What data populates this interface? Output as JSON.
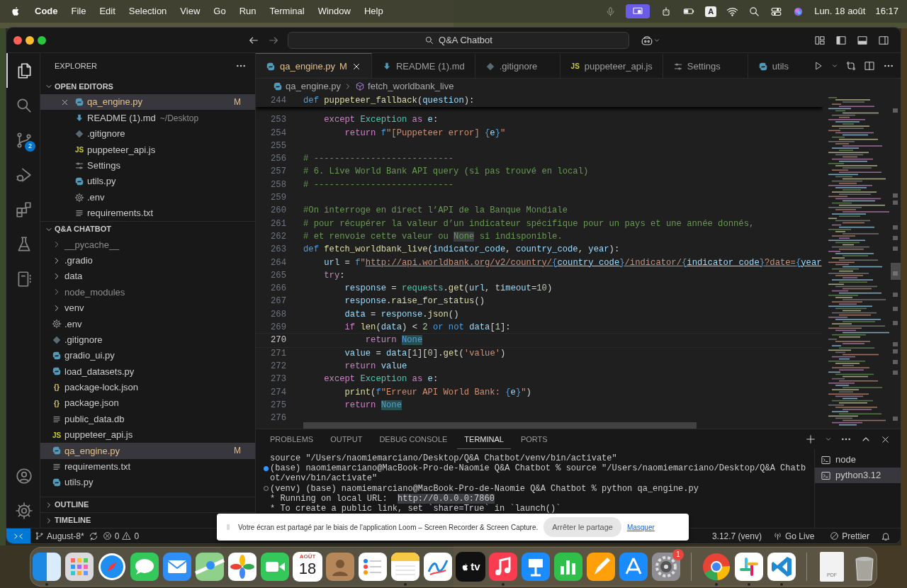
{
  "menu_bar": {
    "app": "Code",
    "menus": [
      "File",
      "Edit",
      "Selection",
      "View",
      "Go",
      "Run",
      "Terminal",
      "Window",
      "Help"
    ],
    "input_source": "A",
    "date": "Lun. 18 août",
    "time": "16:17"
  },
  "window": {
    "title": "Q&A Chatbot"
  },
  "activity_bar": [
    {
      "kind": "explorer",
      "selected": true
    },
    {
      "kind": "search",
      "selected": false
    },
    {
      "kind": "source-control",
      "selected": false,
      "badge": "2"
    },
    {
      "kind": "run-debug",
      "selected": false
    },
    {
      "kind": "extensions",
      "selected": false
    },
    {
      "kind": "testing",
      "selected": false
    },
    {
      "kind": "notebook",
      "selected": false
    }
  ],
  "activity_bar_bottom": [
    {
      "kind": "account"
    },
    {
      "kind": "settings"
    }
  ],
  "sidebar": {
    "title": "EXPLORER",
    "sections": [
      {
        "kind": "open-editors",
        "title": "OPEN EDITORS",
        "expanded": true,
        "items": [
          {
            "label": "qa_engine.py",
            "kind": "python-file",
            "status": "M",
            "selected": true
          },
          {
            "label": "README (1).md",
            "kind": "markdown-file",
            "description": "~/Desktop",
            "selected": false
          },
          {
            "label": ".gitignore",
            "kind": "git-file",
            "selected": false
          },
          {
            "label": "puppeteer_api.js",
            "kind": "js-file",
            "icon_text": "JS",
            "selected": false
          },
          {
            "label": "Settings",
            "kind": "settings-editor",
            "selected": false
          },
          {
            "label": "utils.py",
            "kind": "python-file",
            "selected": false
          },
          {
            "label": ".env",
            "kind": "env-file",
            "selected": false
          },
          {
            "label": "requirements.txt",
            "kind": "text-file",
            "selected": false
          }
        ]
      },
      {
        "kind": "folder-tree",
        "title": "Q&A CHATBOT",
        "expanded": true,
        "items": [
          {
            "label": "__pycache__",
            "kind": "folder",
            "expanded": false,
            "ignored": true,
            "selected": false
          },
          {
            "label": ".gradio",
            "kind": "folder",
            "expanded": false,
            "ignored": false,
            "selected": false
          },
          {
            "label": "data",
            "kind": "folder",
            "expanded": false,
            "ignored": false,
            "selected": false
          },
          {
            "label": "node_modules",
            "kind": "folder",
            "expanded": false,
            "ignored": true,
            "selected": false
          },
          {
            "label": "venv",
            "kind": "folder",
            "expanded": false,
            "ignored": false,
            "selected": false
          },
          {
            "label": ".env",
            "kind": "env-file",
            "ignored": false,
            "selected": false
          },
          {
            "label": ".gitignore",
            "kind": "git-file",
            "ignored": false,
            "selected": false
          },
          {
            "label": "gradio_ui.py",
            "kind": "python-file",
            "ignored": false,
            "selected": false
          },
          {
            "label": "load_datasets.py",
            "kind": "python-file",
            "ignored": false,
            "selected": false
          },
          {
            "label": "package-lock.json",
            "kind": "json-file",
            "icon_text": "{}",
            "ignored": false,
            "selected": false
          },
          {
            "label": "package.json",
            "kind": "json-file",
            "icon_text": "{}",
            "ignored": false,
            "selected": false
          },
          {
            "label": "public_data.db",
            "kind": "text-file",
            "ignored": false,
            "selected": false
          },
          {
            "label": "puppeteer_api.js",
            "kind": "js-file",
            "icon_text": "JS",
            "ignored": false,
            "selected": false
          },
          {
            "label": "qa_engine.py",
            "kind": "python-file",
            "status": "M",
            "ignored": false,
            "selected": true
          },
          {
            "label": "requirements.txt",
            "kind": "text-file",
            "ignored": false,
            "selected": false
          },
          {
            "label": "utils.py",
            "kind": "python-file",
            "ignored": false,
            "selected": false
          }
        ]
      },
      {
        "kind": "collapsed",
        "title": "OUTLINE",
        "expanded": false
      },
      {
        "kind": "collapsed",
        "title": "TIMELINE",
        "expanded": false
      }
    ]
  },
  "tabs": [
    {
      "label": "qa_engine.py",
      "kind": "python-file",
      "status": "M",
      "selected": true
    },
    {
      "label": "README (1).md",
      "kind": "markdown-file",
      "selected": false
    },
    {
      "label": ".gitignore",
      "kind": "git-file",
      "selected": false
    },
    {
      "label": "puppeteer_api.js",
      "kind": "js-file",
      "icon_text": "JS",
      "selected": false
    },
    {
      "label": "Settings",
      "kind": "settings-editor",
      "selected": false
    },
    {
      "label": "utils",
      "kind": "python-file",
      "selected": false
    }
  ],
  "breadcrumb": [
    {
      "label": "qa_engine.py",
      "kind": "python-file"
    },
    {
      "label": "fetch_worldbank_live",
      "kind": "method"
    }
  ],
  "editor": {
    "sticky_line": {
      "number": "244",
      "segments": [
        {
          "kind": "storage",
          "text": "def "
        },
        {
          "kind": "fn",
          "text": "puppeteer_fallback"
        },
        {
          "kind": "plain",
          "text": "("
        },
        {
          "kind": "var",
          "text": "question"
        },
        {
          "kind": "plain",
          "text": "):"
        }
      ]
    },
    "lines": [
      {
        "number": "253",
        "current": false,
        "segments": [
          {
            "kind": "kw",
            "text": "    except "
          },
          {
            "kind": "cls",
            "text": "Exception "
          },
          {
            "kind": "kw",
            "text": "as "
          },
          {
            "kind": "var",
            "text": "e"
          },
          {
            "kind": "plain",
            "text": ":"
          }
        ]
      },
      {
        "number": "254",
        "current": false,
        "segments": [
          {
            "kind": "kw",
            "text": "        return "
          },
          {
            "kind": "storage",
            "text": "f"
          },
          {
            "kind": "str",
            "text": "\"[Puppeteer error] "
          },
          {
            "kind": "brace",
            "text": "{"
          },
          {
            "kind": "var",
            "text": "e"
          },
          {
            "kind": "brace",
            "text": "}"
          },
          {
            "kind": "str",
            "text": "\""
          }
        ]
      },
      {
        "number": "255",
        "current": false
      },
      {
        "number": "256",
        "current": false,
        "segments": [
          {
            "kind": "cmt",
            "text": "# ---------------------------"
          }
        ]
      },
      {
        "number": "257",
        "current": false,
        "segments": [
          {
            "kind": "cmt",
            "text": "# 6. Live World Bank API query (si pas trouvé en local)"
          }
        ]
      },
      {
        "number": "258",
        "current": false,
        "segments": [
          {
            "kind": "cmt",
            "text": "# ---------------------------"
          }
        ]
      },
      {
        "number": "259",
        "current": false
      },
      {
        "number": "260",
        "current": false,
        "segments": [
          {
            "kind": "cmt",
            "text": "#On interroge en direct l’API de la Banque Mondiale"
          }
        ]
      },
      {
        "number": "261",
        "current": false,
        "segments": [
          {
            "kind": "cmt",
            "text": "# pour récupérer la valeur d’un indicateur spécifique pour un pays et une année donnés,"
          }
        ]
      },
      {
        "number": "262",
        "current": false,
        "segments": [
          {
            "kind": "cmt",
            "text": "# et renvoie cette valeur ou "
          },
          {
            "kind": "cmt-hl",
            "text": "None"
          },
          {
            "kind": "cmt",
            "text": " si indisponible."
          }
        ]
      },
      {
        "number": "263",
        "current": false,
        "segments": [
          {
            "kind": "storage",
            "text": "def "
          },
          {
            "kind": "fn",
            "text": "fetch_worldbank_live"
          },
          {
            "kind": "plain",
            "text": "("
          },
          {
            "kind": "var",
            "text": "indicator_code"
          },
          {
            "kind": "plain",
            "text": ", "
          },
          {
            "kind": "var",
            "text": "country_code"
          },
          {
            "kind": "plain",
            "text": ", "
          },
          {
            "kind": "var",
            "text": "year"
          },
          {
            "kind": "plain",
            "text": "):"
          }
        ]
      },
      {
        "number": "264",
        "current": false,
        "segments": [
          {
            "kind": "var",
            "text": "    url"
          },
          {
            "kind": "plain",
            "text": " = "
          },
          {
            "kind": "storage",
            "text": "f"
          },
          {
            "kind": "str",
            "text": "\""
          },
          {
            "kind": "url",
            "text": "http://api.worldbank.org/v2/country/"
          },
          {
            "kind": "url-brace",
            "text": "{"
          },
          {
            "kind": "url-var",
            "text": "country_code"
          },
          {
            "kind": "url-brace",
            "text": "}"
          },
          {
            "kind": "url",
            "text": "/indicator/"
          },
          {
            "kind": "url-brace",
            "text": "{"
          },
          {
            "kind": "url-var",
            "text": "indicator_code"
          },
          {
            "kind": "url-brace",
            "text": "}"
          },
          {
            "kind": "url",
            "text": "?date="
          },
          {
            "kind": "url-brace",
            "text": "{"
          },
          {
            "kind": "url-var",
            "text": "year"
          }
        ]
      },
      {
        "number": "265",
        "current": false,
        "segments": [
          {
            "kind": "kw",
            "text": "    try"
          },
          {
            "kind": "plain",
            "text": ":"
          }
        ]
      },
      {
        "number": "266",
        "current": false,
        "segments": [
          {
            "kind": "var",
            "text": "        response"
          },
          {
            "kind": "plain",
            "text": " = "
          },
          {
            "kind": "cls",
            "text": "requests"
          },
          {
            "kind": "plain",
            "text": "."
          },
          {
            "kind": "fn",
            "text": "get"
          },
          {
            "kind": "plain",
            "text": "("
          },
          {
            "kind": "var",
            "text": "url"
          },
          {
            "kind": "plain",
            "text": ", "
          },
          {
            "kind": "var",
            "text": "timeout"
          },
          {
            "kind": "plain",
            "text": "="
          },
          {
            "kind": "num",
            "text": "10"
          },
          {
            "kind": "plain",
            "text": ")"
          }
        ]
      },
      {
        "number": "267",
        "current": false,
        "segments": [
          {
            "kind": "var",
            "text": "        response"
          },
          {
            "kind": "plain",
            "text": "."
          },
          {
            "kind": "fn",
            "text": "raise_for_status"
          },
          {
            "kind": "plain",
            "text": "()"
          }
        ]
      },
      {
        "number": "268",
        "current": false,
        "segments": [
          {
            "kind": "var",
            "text": "        data"
          },
          {
            "kind": "plain",
            "text": " = "
          },
          {
            "kind": "var",
            "text": "response"
          },
          {
            "kind": "plain",
            "text": "."
          },
          {
            "kind": "fn",
            "text": "json"
          },
          {
            "kind": "plain",
            "text": "()"
          }
        ]
      },
      {
        "number": "269",
        "current": false,
        "segments": [
          {
            "kind": "kw",
            "text": "        if "
          },
          {
            "kind": "fn",
            "text": "len"
          },
          {
            "kind": "plain",
            "text": "("
          },
          {
            "kind": "var",
            "text": "data"
          },
          {
            "kind": "plain",
            "text": ") < "
          },
          {
            "kind": "num",
            "text": "2 "
          },
          {
            "kind": "storage",
            "text": "or "
          },
          {
            "kind": "storage",
            "text": "not "
          },
          {
            "kind": "var",
            "text": "data"
          },
          {
            "kind": "plain",
            "text": "["
          },
          {
            "kind": "num",
            "text": "1"
          },
          {
            "kind": "plain",
            "text": "]:"
          }
        ]
      },
      {
        "number": "270",
        "current": true,
        "segments": [
          {
            "kind": "kw",
            "text": "            return "
          },
          {
            "kind": "const-hl",
            "text": "None"
          }
        ]
      },
      {
        "number": "271",
        "current": false,
        "segments": [
          {
            "kind": "var",
            "text": "        value"
          },
          {
            "kind": "plain",
            "text": " = "
          },
          {
            "kind": "var",
            "text": "data"
          },
          {
            "kind": "plain",
            "text": "["
          },
          {
            "kind": "num",
            "text": "1"
          },
          {
            "kind": "plain",
            "text": "]["
          },
          {
            "kind": "num",
            "text": "0"
          },
          {
            "kind": "plain",
            "text": "]."
          },
          {
            "kind": "fn",
            "text": "get"
          },
          {
            "kind": "plain",
            "text": "("
          },
          {
            "kind": "str",
            "text": "'value'"
          },
          {
            "kind": "plain",
            "text": ")"
          }
        ]
      },
      {
        "number": "272",
        "current": false,
        "segments": [
          {
            "kind": "kw",
            "text": "        return "
          },
          {
            "kind": "var",
            "text": "value"
          }
        ]
      },
      {
        "number": "273",
        "current": false,
        "segments": [
          {
            "kind": "kw",
            "text": "    except "
          },
          {
            "kind": "cls",
            "text": "Exception "
          },
          {
            "kind": "kw",
            "text": "as "
          },
          {
            "kind": "var",
            "text": "e"
          },
          {
            "kind": "plain",
            "text": ":"
          }
        ]
      },
      {
        "number": "274",
        "current": false,
        "segments": [
          {
            "kind": "fn",
            "text": "        print"
          },
          {
            "kind": "plain",
            "text": "("
          },
          {
            "kind": "storage",
            "text": "f"
          },
          {
            "kind": "str",
            "text": "\"Erreur API World Bank: "
          },
          {
            "kind": "brace",
            "text": "{"
          },
          {
            "kind": "var",
            "text": "e"
          },
          {
            "kind": "brace",
            "text": "}"
          },
          {
            "kind": "str",
            "text": "\""
          },
          {
            "kind": "plain",
            "text": ")"
          }
        ]
      },
      {
        "number": "275",
        "current": false,
        "segments": [
          {
            "kind": "kw",
            "text": "        return "
          },
          {
            "kind": "const-hl",
            "text": "None"
          }
        ]
      },
      {
        "number": "276",
        "current": false
      }
    ]
  },
  "panel": {
    "tabs": [
      {
        "label": "PROBLEMS",
        "selected": false
      },
      {
        "label": "OUTPUT",
        "selected": false
      },
      {
        "label": "DEBUG CONSOLE",
        "selected": false
      },
      {
        "label": "TERMINAL",
        "selected": true
      },
      {
        "label": "PORTS",
        "selected": false
      }
    ],
    "terminal_lines": [
      {
        "kind": "output",
        "segments": [
          {
            "kind": "plain",
            "text": "source \"/Users/naomiemarciano/Desktop/Q&A Chatbot/venv/bin/activate\""
          }
        ]
      },
      {
        "kind": "command-success",
        "segments": [
          {
            "kind": "plain",
            "text": "(base) naomiemarciano@MacBook-Pro-de-Naomie Q&A Chatbot % source \"/Users/naomiemarciano/Desktop/Q&A Chatb"
          }
        ]
      },
      {
        "kind": "output",
        "segments": [
          {
            "kind": "plain",
            "text": "ot/venv/bin/activate\""
          }
        ]
      },
      {
        "kind": "command-running",
        "segments": [
          {
            "kind": "plain",
            "text": "(venv) (base) naomiemarciano@MacBook-Pro-de-Naomie Q&A Chatbot % python qa_engine.py"
          }
        ]
      },
      {
        "kind": "output",
        "segments": [
          {
            "kind": "plain",
            "text": "* Running on local URL:  "
          },
          {
            "kind": "link",
            "text": "http://0.0.0.0:7860"
          }
        ]
      },
      {
        "kind": "output",
        "segments": [
          {
            "kind": "plain",
            "text": "* To create a public link, set `share=True` in `launch()`"
          }
        ]
      }
    ],
    "terminals": [
      {
        "label": "node",
        "selected": false
      },
      {
        "label": "python3.12",
        "selected": true
      }
    ]
  },
  "status_bar": {
    "branch": "August-8*",
    "errors": "0",
    "warnings": "0",
    "interpreter": "3.12.7 (venv)",
    "live_server": "Go Live",
    "formatter": "Prettier"
  },
  "notification": {
    "message": "Votre écran est partagé par le biais de l'application Loom – Screen Recorder & Screen Capture.",
    "button": "Arrêter le partage",
    "link": "Masquer"
  },
  "dock": [
    {
      "kind": "finder",
      "running": true
    },
    {
      "kind": "launchpad",
      "running": false
    },
    {
      "kind": "safari",
      "running": false
    },
    {
      "kind": "messages",
      "running": false
    },
    {
      "kind": "mail",
      "running": false
    },
    {
      "kind": "maps",
      "running": false
    },
    {
      "kind": "photos",
      "running": false
    },
    {
      "kind": "facetime",
      "running": false
    },
    {
      "kind": "calendar",
      "month": "AOÛT",
      "day": "18",
      "running": false
    },
    {
      "kind": "contacts",
      "running": false
    },
    {
      "kind": "reminders",
      "running": false
    },
    {
      "kind": "notes",
      "running": true
    },
    {
      "kind": "freeform",
      "running": false
    },
    {
      "kind": "tv",
      "label": "tv",
      "running": false
    },
    {
      "kind": "music",
      "running": true
    },
    {
      "kind": "keynote",
      "running": false
    },
    {
      "kind": "numbers",
      "running": false
    },
    {
      "kind": "pages",
      "running": false
    },
    {
      "kind": "appstore",
      "running": false
    },
    {
      "kind": "settings",
      "badge": "1",
      "running": false
    },
    {
      "kind": "separator"
    },
    {
      "kind": "chrome",
      "running": true
    },
    {
      "kind": "slack",
      "running": true
    },
    {
      "kind": "vscode",
      "running": true
    },
    {
      "kind": "separator"
    },
    {
      "kind": "document",
      "label": "PDF"
    },
    {
      "kind": "trash"
    }
  ]
}
